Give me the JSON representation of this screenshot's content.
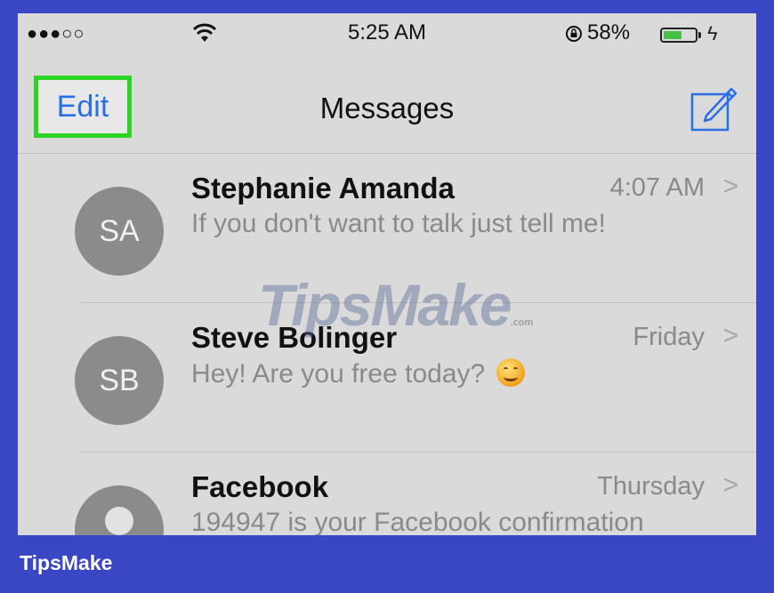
{
  "status_bar": {
    "signal": "●●●○○",
    "time": "5:25 AM",
    "battery_percent": "58%",
    "battery_level": 0.58,
    "charging_icon": "lightning-icon"
  },
  "nav": {
    "edit_label": "Edit",
    "title": "Messages",
    "compose_icon": "compose-icon"
  },
  "conversations": [
    {
      "initials": "SA",
      "name": "Stephanie Amanda",
      "time": "4:07 AM",
      "preview": "If you don't want to talk just tell me!"
    },
    {
      "initials": "SB",
      "name": "Steve Bolinger",
      "time": "Friday",
      "preview": "Hey! Are you free today?"
    },
    {
      "initials": "",
      "name": "Facebook",
      "time": "Thursday",
      "preview": "194947 is your Facebook confirmation"
    }
  ],
  "watermark": {
    "text": "TipsMake",
    "suffix": ".com"
  },
  "footer": {
    "brand": "TipsMake"
  },
  "colors": {
    "frame": "#3a47c4",
    "highlight": "#2ed424",
    "link": "#2a6fe3",
    "screen": "#dadada"
  }
}
